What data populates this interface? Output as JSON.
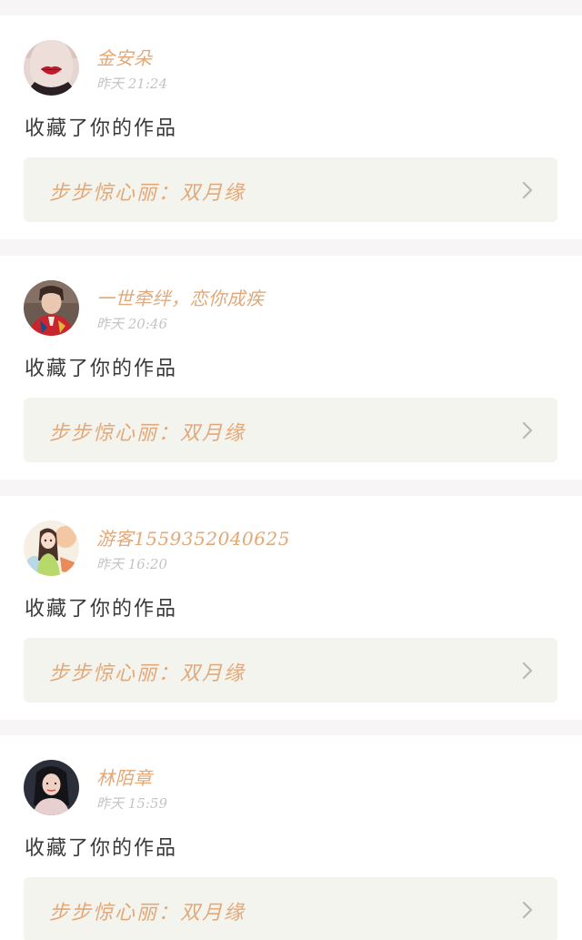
{
  "notifications": [
    {
      "username": "金安朵",
      "time": "昨天 21:24",
      "action": "收藏了你的作品",
      "work_title": "步步惊心丽：双月缘",
      "avatar_icon": "lips-avatar-icon"
    },
    {
      "username": "一世牵绊，恋你成疾",
      "time": "昨天 20:46",
      "action": "收藏了你的作品",
      "work_title": "步步惊心丽：双月缘",
      "avatar_icon": "boy-portrait-avatar-icon"
    },
    {
      "username": "游客1559352040625",
      "time": "昨天 16:20",
      "action": "收藏了你的作品",
      "work_title": "步步惊心丽：双月缘",
      "avatar_icon": "anime-girl-avatar-icon"
    },
    {
      "username": "林陌章",
      "time": "昨天 15:59",
      "action": "收藏了你的作品",
      "work_title": "步步惊心丽：双月缘",
      "avatar_icon": "woman-portrait-avatar-icon"
    }
  ],
  "colors": {
    "accent": "#e3a878",
    "timestamp": "#c8c3c3",
    "body_text": "#3a3a3a",
    "link_background": "#f4f4ee",
    "page_background": "#f7f5f5"
  }
}
